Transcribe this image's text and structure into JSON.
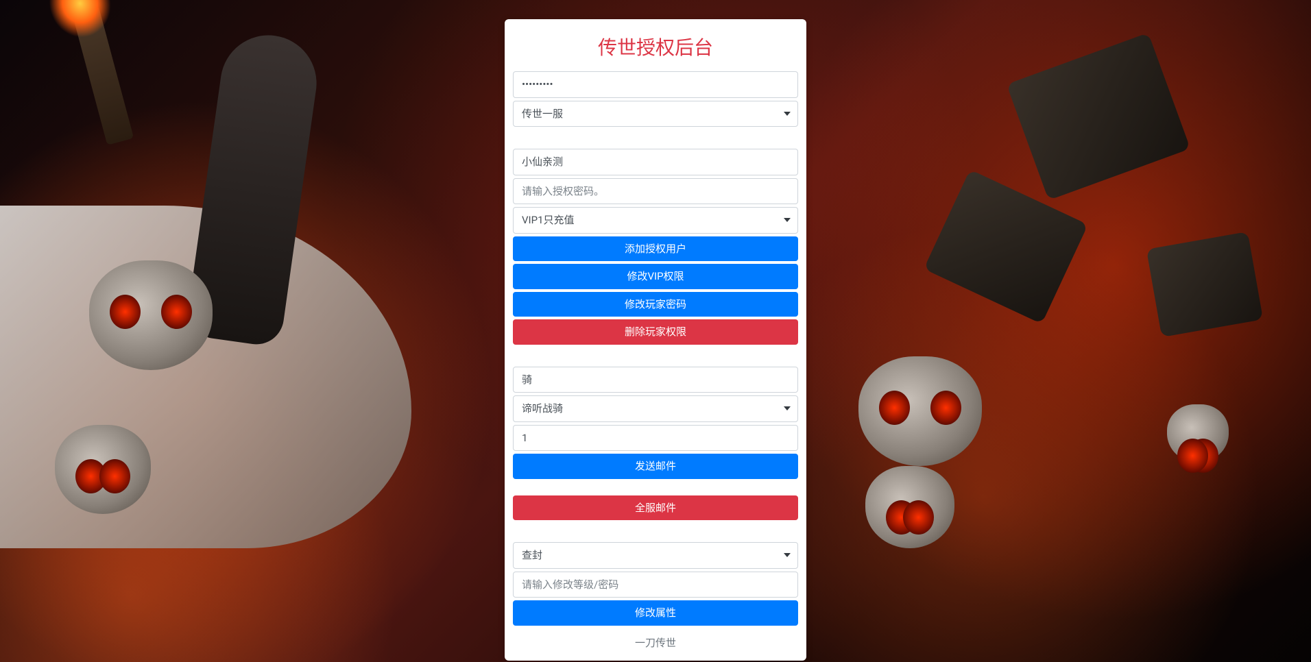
{
  "title": "传世授权后台",
  "section1": {
    "password_value": "•••••••••",
    "server_select_value": "传世一服"
  },
  "section2": {
    "player_name_value": "小仙亲测",
    "auth_password_placeholder": "请输入授权密码。",
    "vip_select_value": "VIP1只充值",
    "btn_add_user": "添加授权用户",
    "btn_modify_vip": "修改VIP权限",
    "btn_modify_password": "修改玩家密码",
    "btn_delete_auth": "删除玩家权限"
  },
  "section3": {
    "item_char_value": "骑",
    "item_select_value": "谛听战骑",
    "quantity_value": "1",
    "btn_send_mail": "发送邮件"
  },
  "section4": {
    "btn_server_mail": "全服邮件"
  },
  "section5": {
    "action_select_value": "查封",
    "level_placeholder": "请输入修改等级/密码",
    "btn_modify_attr": "修改属性"
  },
  "footer": "一刀传世"
}
